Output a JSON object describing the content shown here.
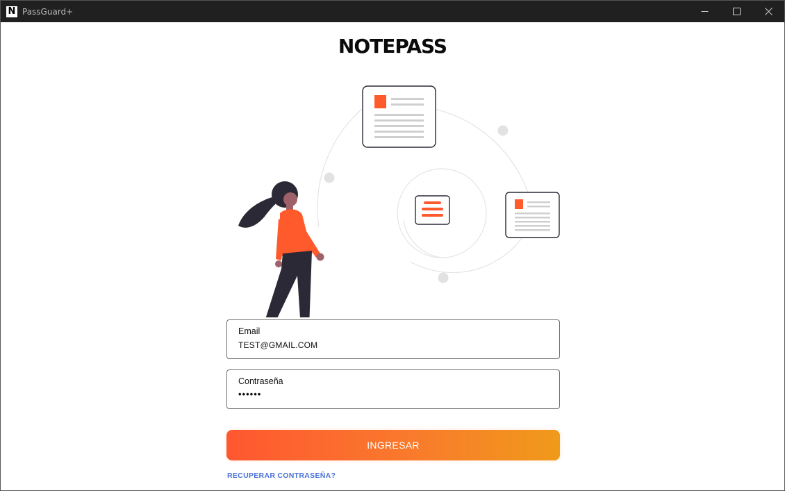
{
  "window": {
    "title": "PassGuard+",
    "app_icon_letter": "N",
    "controls": [
      "minimize-icon",
      "maximize-icon",
      "close-icon"
    ]
  },
  "brand": {
    "logo_text": "NOTEPASS",
    "accent_color": "#ff5a2c",
    "dark_color": "#2c2936"
  },
  "form": {
    "email": {
      "label": "Email",
      "value": "TEST@GMAIL.COM"
    },
    "password": {
      "label": "Contraseña",
      "value": "••••••"
    },
    "submit_label": "INGRESAR",
    "recover_label": "RECUPERAR CONTRASEÑA?",
    "button_gradient": [
      "#ff5730",
      "#f09a1a"
    ],
    "link_color": "#4a72d6"
  }
}
